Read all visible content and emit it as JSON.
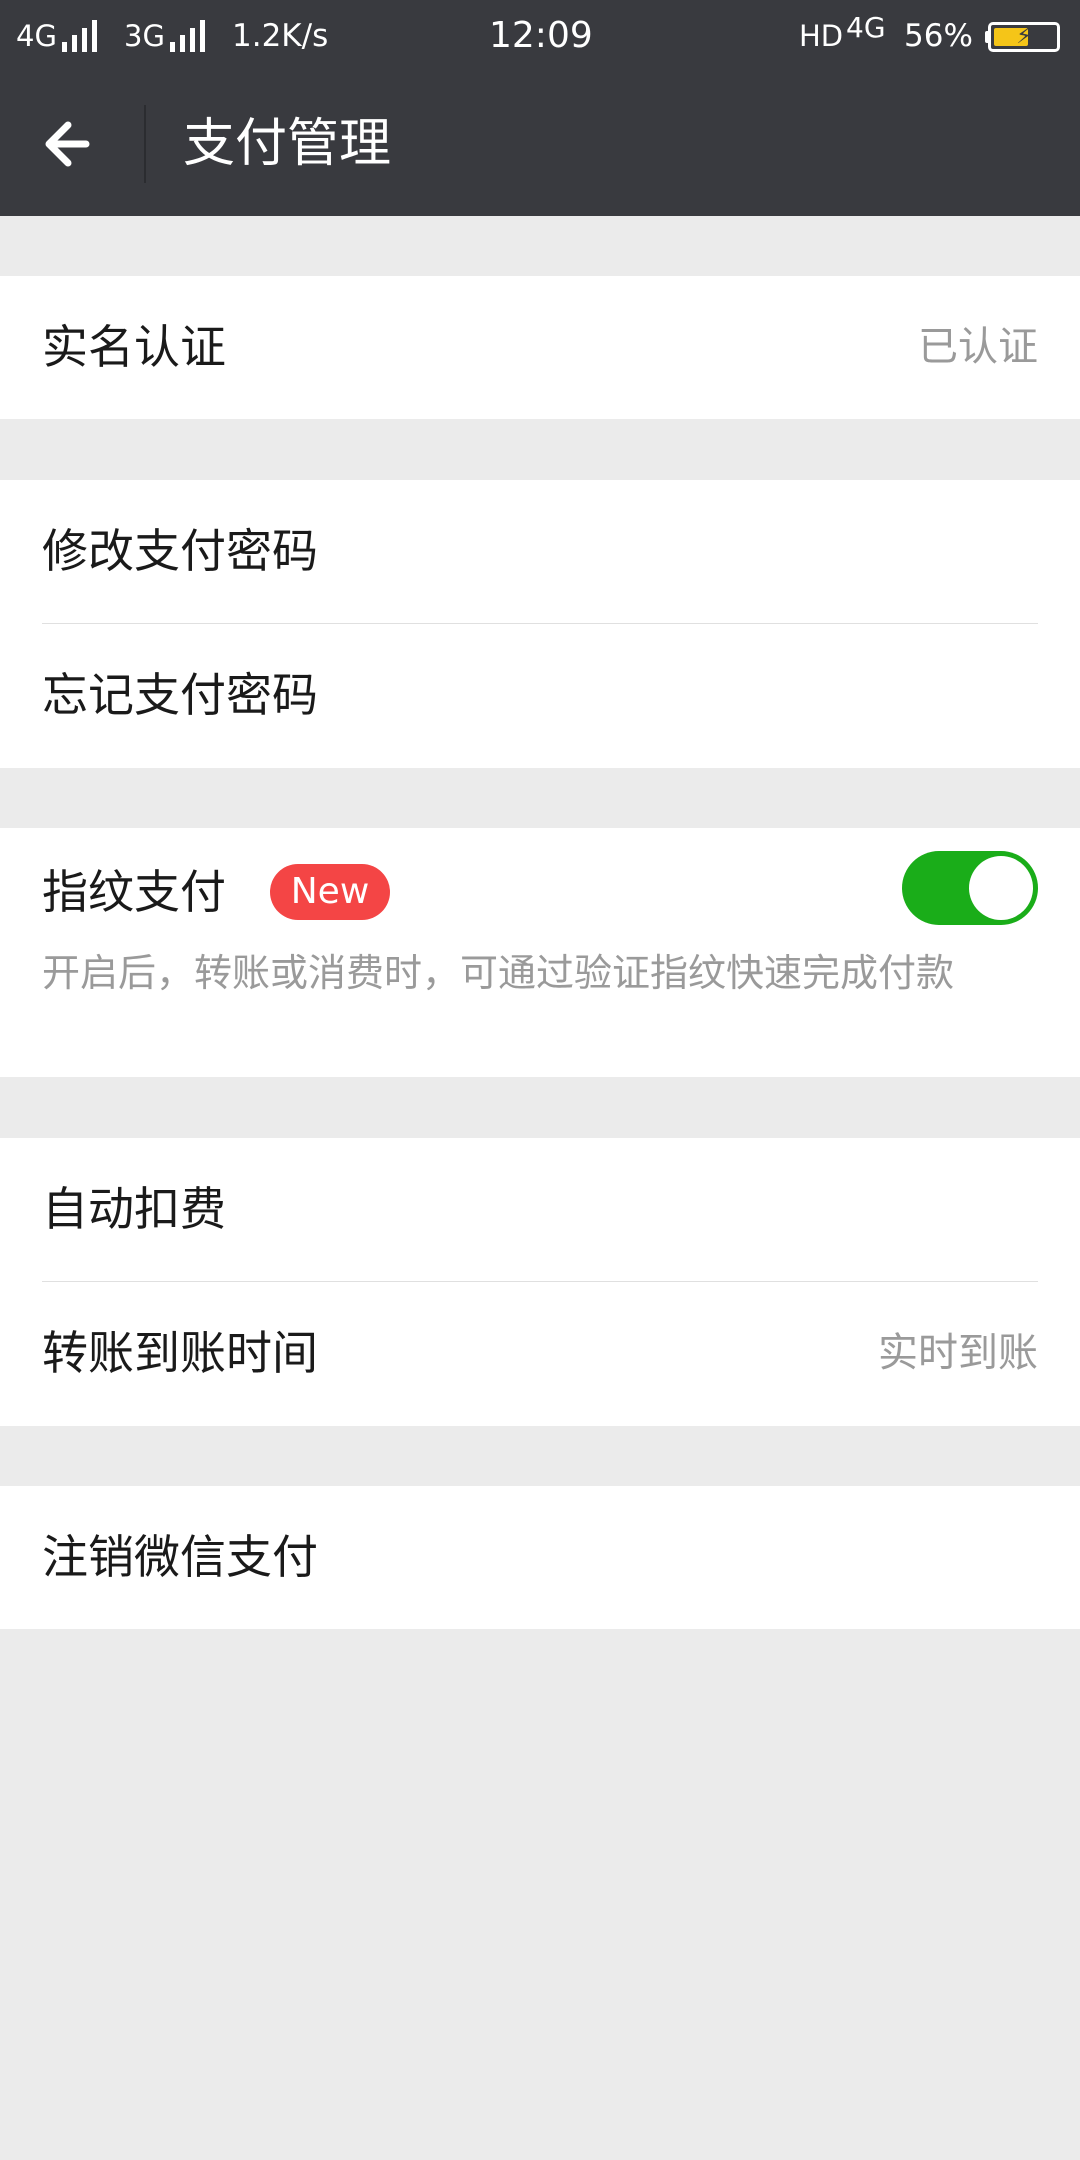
{
  "status_bar": {
    "network_1": "4G",
    "network_2": "3G",
    "speed": "1.2K/s",
    "time": "12:09",
    "hd": "HD",
    "network_3": "4G",
    "battery_percent": "56%",
    "battery_level": 0.56,
    "charging": true
  },
  "title_bar": {
    "back_icon": "arrow-left-icon",
    "title": "支付管理"
  },
  "groups": {
    "real_name": {
      "label": "实名认证",
      "value": "已认证"
    },
    "password": {
      "change_label": "修改支付密码",
      "forgot_label": "忘记支付密码"
    },
    "fingerprint": {
      "label": "指纹支付",
      "badge": "New",
      "enabled": true,
      "description": "开启后，转账或消费时，可通过验证指纹快速完成付款"
    },
    "payments": {
      "auto_deduct_label": "自动扣费",
      "transfer_time_label": "转账到账时间",
      "transfer_time_value": "实时到账"
    },
    "cancel": {
      "label": "注销微信支付"
    }
  },
  "colors": {
    "bar_background": "#393a3f",
    "page_background": "#ebebeb",
    "toggle_on": "#1aad19",
    "badge_red": "#f44545",
    "secondary_text": "#9a9a9a"
  }
}
